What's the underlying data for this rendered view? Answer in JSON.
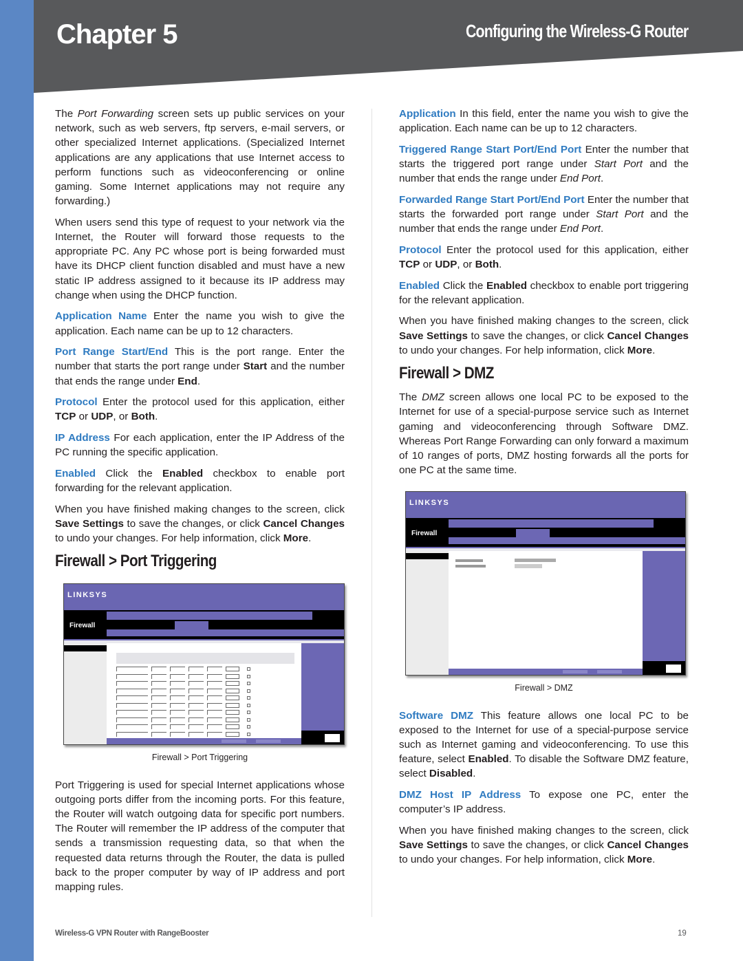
{
  "header": {
    "chapter": "Chapter 5",
    "subtitle": "Configuring the Wireless-G Router"
  },
  "colors": {
    "side_bar": "#5b87c5",
    "header_band": "#58595b",
    "term_blue": "#2f7bc1",
    "screenshot_purple": "#6c67b4"
  },
  "left_column": {
    "intro_p1": {
      "t1": "The ",
      "italic": "Port Forwarding",
      "t2": " screen sets up public services on your network, such as web servers, ftp servers, e-mail servers, or other specialized Internet applications. (Specialized Internet applications are any applications that use Internet access to perform functions such as videoconferencing or online gaming. Some Internet applications may not require any forwarding.)"
    },
    "intro_p2": "When users send this type of request to your network via the Internet, the Router will forward those requests to the appropriate PC. Any PC whose port is being forwarded must have its DHCP client function disabled and must have a new static IP address assigned to it because its IP address may change when using the DHCP function.",
    "app_name": {
      "term": "Application Name",
      "text": "  Enter the name you wish to give the application. Each name can be up to 12 characters."
    },
    "port_range": {
      "term": "Port Range Start/End",
      "t1": "  This is the port range. Enter the number that starts the port range under ",
      "b1": "Start",
      "t2": " and the number that ends the range under ",
      "b2": "End",
      "t3": "."
    },
    "protocol": {
      "term": "Protocol",
      "t1": "  Enter the protocol used for this application, either ",
      "b1": "TCP",
      "t2": " or ",
      "b2": "UDP",
      "t3": ", or ",
      "b3": "Both",
      "t4": "."
    },
    "ip_address": {
      "term": "IP Address",
      "text": "  For each application, enter the IP Address of the PC running the specific application."
    },
    "enabled": {
      "term": "Enabled",
      "t1": "  Click the ",
      "b1": "Enabled",
      "t2": " checkbox to enable port forwarding for the relevant application."
    },
    "finish": {
      "t1": "When you have finished making changes to the screen, click ",
      "b1": "Save Settings",
      "t2": " to save the changes, or click ",
      "b2": "Cancel Changes",
      "t3": " to undo your changes. For help information, click ",
      "b3": "More",
      "t4": "."
    },
    "section_heading": "Firewall > Port Triggering",
    "figure": {
      "caption": "Firewall > Port Triggering",
      "logo": "LINKSYS",
      "section": "Firewall"
    },
    "trigger_p": "Port Triggering is used for special Internet applications whose outgoing ports differ from the incoming ports. For this feature, the Router will watch outgoing data for specific port numbers. The Router will remember the IP address of the computer that sends a transmission requesting data, so that when the requested data returns through the Router, the data is pulled back to the proper computer by way of IP address and port mapping rules."
  },
  "right_column": {
    "application": {
      "term": "Application",
      "text": "  In this field, enter the name you wish to give the application. Each name can be up to 12 characters."
    },
    "triggered": {
      "term": "Triggered Range Start Port/End Port",
      "t1": "  Enter the number that starts the triggered port range under ",
      "i1": "Start Port",
      "t2": " and the number that ends the range under ",
      "i2": "End Port",
      "t3": "."
    },
    "forwarded": {
      "term": "Forwarded Range Start Port/End Port",
      "t1": "  Enter the number that starts the forwarded port range under ",
      "i1": "Start Port",
      "t2": " and the number that ends the range under ",
      "i2": "End Port",
      "t3": "."
    },
    "protocol": {
      "term": "Protocol",
      "t1": "  Enter the protocol used for this application, either ",
      "b1": "TCP",
      "t2": " or ",
      "b2": "UDP",
      "t3": ", or ",
      "b3": "Both",
      "t4": "."
    },
    "enabled": {
      "term": "Enabled",
      "t1": "  Click the ",
      "b1": "Enabled",
      "t2": " checkbox to enable port triggering for the relevant application."
    },
    "finish1": {
      "t1": "When you have finished making changes to the screen, click ",
      "b1": "Save Settings",
      "t2": " to save the changes, or click ",
      "b2": "Cancel Changes",
      "t3": " to undo your changes. For help information, click ",
      "b3": "More",
      "t4": "."
    },
    "section_heading": "Firewall > DMZ",
    "dmz_intro": {
      "t1": "The ",
      "italic": "DMZ",
      "t2": " screen allows one local PC to be exposed to the Internet for use of a special-purpose service such as Internet gaming and videoconferencing through Software DMZ. Whereas Port Range Forwarding can only forward a maximum of 10 ranges of ports, DMZ hosting forwards all the ports for one PC at the same time."
    },
    "figure": {
      "caption": "Firewall > DMZ",
      "logo": "LINKSYS",
      "section": "Firewall"
    },
    "software_dmz": {
      "term": "Software DMZ",
      "t1": "  This feature allows one local PC to be exposed to the Internet for use of a special-purpose service such as Internet gaming and videoconferencing. To use this feature, select ",
      "b1": "Enabled",
      "t2": ". To disable the Software DMZ feature, select ",
      "b2": "Disabled",
      "t3": "."
    },
    "dmz_host": {
      "term": "DMZ Host IP Address",
      "text": "  To expose one PC, enter the computer’s IP address."
    },
    "finish2": {
      "t1": "When you have finished making changes to the screen, click ",
      "b1": "Save Settings",
      "t2": " to save the changes, or click ",
      "b2": "Cancel Changes",
      "t3": " to undo your changes. For help information, click ",
      "b3": "More",
      "t4": "."
    }
  },
  "footer": {
    "title": "Wireless-G VPN Router with RangeBooster",
    "page": "19"
  }
}
